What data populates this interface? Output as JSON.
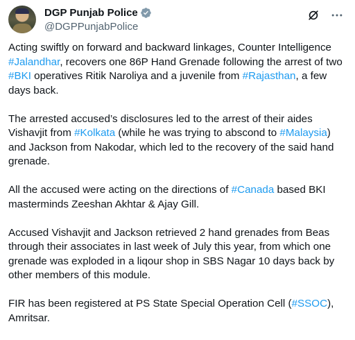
{
  "author": {
    "display_name": "DGP Punjab Police",
    "handle": "@DGPPunjabPolice"
  },
  "icons": {
    "verified": "verified-badge-icon",
    "grok": "grok-icon",
    "more": "more-options-icon"
  },
  "colors": {
    "hashtag": "#1d9bf0",
    "verified": "#829aab",
    "text": "#0f1419",
    "secondary": "#536471"
  },
  "paragraphs": [
    {
      "segments": [
        {
          "text": "Acting swiftly on forward and backward linkages, Counter Intelligence "
        },
        {
          "text": "#Jalandhar",
          "tag": true
        },
        {
          "text": ", recovers one 86P Hand Grenade following the arrest of two "
        },
        {
          "text": "#BKI",
          "tag": true
        },
        {
          "text": " operatives Ritik Naroliya and a juvenile from "
        },
        {
          "text": "#Rajasthan",
          "tag": true
        },
        {
          "text": ", a few days back."
        }
      ]
    },
    {
      "segments": [
        {
          "text": "The arrested accused’s disclosures led to the arrest of their aides Vishavjit from "
        },
        {
          "text": "#Kolkata",
          "tag": true
        },
        {
          "text": " (while he was trying to abscond to "
        },
        {
          "text": "#Malaysia",
          "tag": true
        },
        {
          "text": ") and Jackson from Nakodar, which led to the recovery of the said hand grenade."
        }
      ]
    },
    {
      "segments": [
        {
          "text": "All the accused were acting on the directions of "
        },
        {
          "text": "#Canada",
          "tag": true
        },
        {
          "text": " based BKI masterminds Zeeshan Akhtar & Ajay Gill."
        }
      ]
    },
    {
      "segments": [
        {
          "text": "Accused Vishavjit and Jackson retrieved 2 hand grenades from Beas through their associates in last week of July this year, from which one grenade was exploded in a liqour shop in SBS Nagar 10 days back by other members of this module."
        }
      ]
    },
    {
      "segments": [
        {
          "text": "FIR has been registered at PS State Special Operation Cell ("
        },
        {
          "text": "#SSOC",
          "tag": true
        },
        {
          "text": "), Amritsar."
        }
      ]
    }
  ]
}
